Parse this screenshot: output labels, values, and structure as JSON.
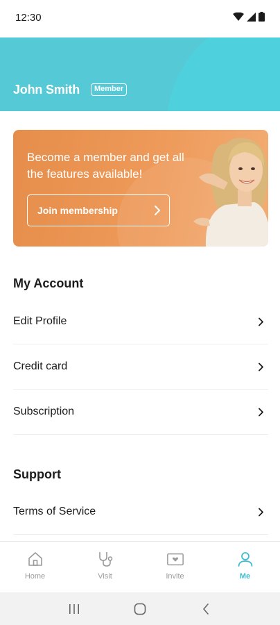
{
  "status_bar": {
    "time": "12:30"
  },
  "profile": {
    "name": "John Smith",
    "badge": "Member"
  },
  "banner": {
    "text": "Become a member and get all the features available!",
    "button_label": "Join membership"
  },
  "my_account": {
    "title": "My Account",
    "items": [
      {
        "label": "Edit Profile"
      },
      {
        "label": "Credit card"
      },
      {
        "label": "Subscription"
      }
    ]
  },
  "support": {
    "title": "Support",
    "items": [
      {
        "label": "Terms of Service"
      }
    ]
  },
  "bottom_nav": {
    "items": [
      {
        "label": "Home",
        "icon": "home-icon",
        "active": false
      },
      {
        "label": "Visit",
        "icon": "stethoscope-icon",
        "active": false
      },
      {
        "label": "Invite",
        "icon": "invite-card-icon",
        "active": false
      },
      {
        "label": "Me",
        "icon": "person-icon",
        "active": true
      }
    ]
  },
  "colors": {
    "header": "#56c9d6",
    "banner": "#ee9a5a",
    "accent": "#3fbcd0"
  }
}
